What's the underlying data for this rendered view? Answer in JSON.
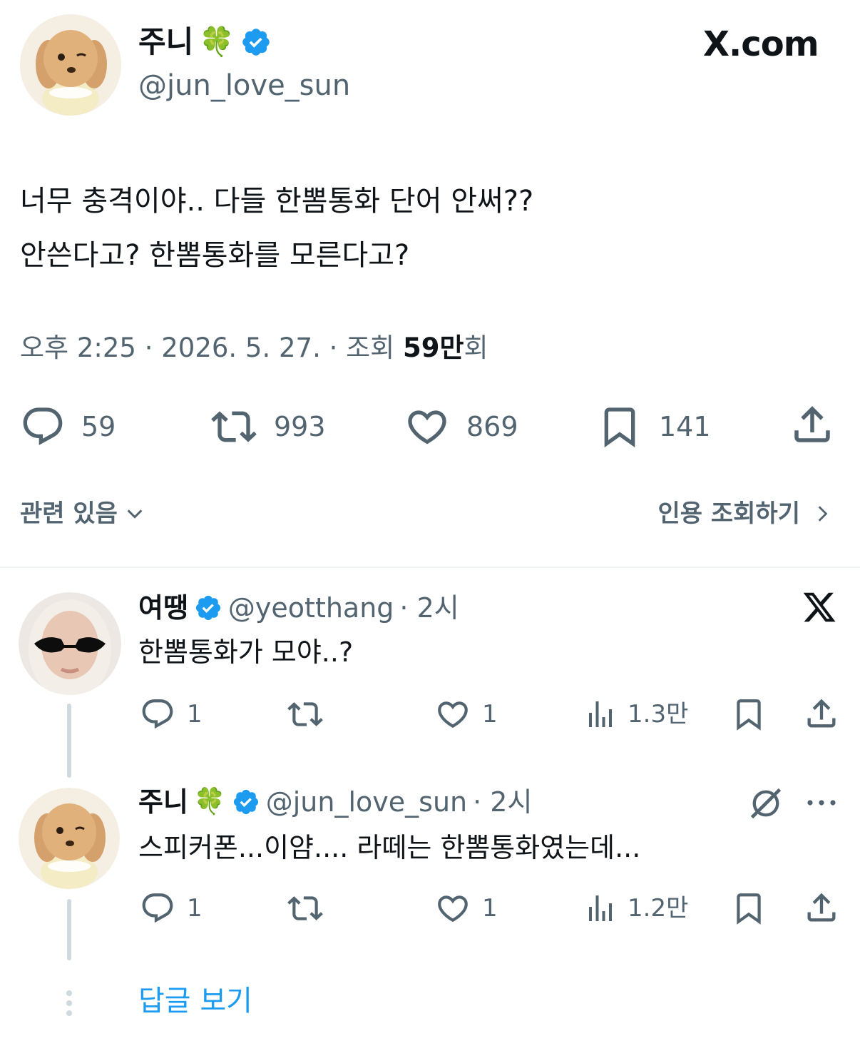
{
  "header": {
    "display_name": "주니",
    "name_emoji": "🍀",
    "handle": "@jun_love_sun",
    "brand": "X.com",
    "verified_color": "#1d9bf0"
  },
  "tweet": {
    "line1": "너무 충격이야.. 다들 한뽐통화 단어 안써??",
    "line2": "안쓴다고? 한뽐통화를 모른다고?",
    "time": "오후 2:25",
    "date": "2026. 5. 27.",
    "views_label": "조회",
    "views_count": "59만",
    "views_suffix": "회",
    "sep": "·"
  },
  "actions": {
    "replies": "59",
    "retweets": "993",
    "likes": "869",
    "bookmarks": "141"
  },
  "related": {
    "label": "관련 있음"
  },
  "quotes": {
    "label": "인용 조회하기"
  },
  "replies": [
    {
      "name": "여땡",
      "handle": "@yeotthang",
      "time": "· 2시",
      "text": "한뽐통화가 모야..?",
      "reply_count": "1",
      "like_count": "1",
      "views": "1.3만"
    },
    {
      "name": "주니",
      "name_emoji": "🍀",
      "handle": "@jun_love_sun",
      "time": "· 2시",
      "text": "스피커폰...이얌.... 라떼는 한뽐통화였는데...",
      "reply_count": "1",
      "like_count": "1",
      "views": "1.2만"
    }
  ],
  "show_replies": {
    "label": "답글 보기"
  },
  "colors": {
    "text": "#0f1419",
    "muted": "#536471",
    "accent": "#1d9bf0",
    "line": "#cfd9de"
  }
}
